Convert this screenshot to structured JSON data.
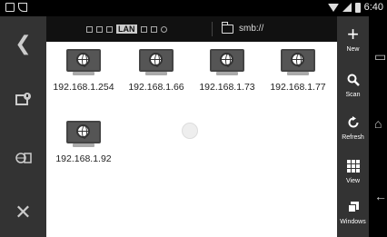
{
  "status_bar": {
    "time": "6:40",
    "left_icons": [
      "image-icon",
      "cast-icon"
    ],
    "right_icons": [
      "wifi-icon",
      "signal-icon",
      "battery-icon"
    ]
  },
  "left_panel": {
    "icons": [
      "chevron-left-icon",
      "network-storage-icon",
      "device-icon",
      "close-icon"
    ]
  },
  "path_bar": {
    "tag": "LAN",
    "path": "smb://"
  },
  "hosts": [
    {
      "name": "192.168.1.254"
    },
    {
      "name": "192.168.1.66"
    },
    {
      "name": "192.168.1.73"
    },
    {
      "name": "192.168.1.77"
    },
    {
      "name": "192.168.1.92"
    }
  ],
  "right_panel": {
    "buttons": [
      {
        "label": "New",
        "icon": "plus-icon"
      },
      {
        "label": "Scan",
        "icon": "search-icon"
      },
      {
        "label": "Refresh",
        "icon": "refresh-icon"
      },
      {
        "label": "View",
        "icon": "grid-icon"
      },
      {
        "label": "Windows",
        "icon": "windows-icon"
      }
    ]
  },
  "colors": {
    "panel": "#333333",
    "content_bg": "#ffffff",
    "status_bg": "#000000"
  }
}
